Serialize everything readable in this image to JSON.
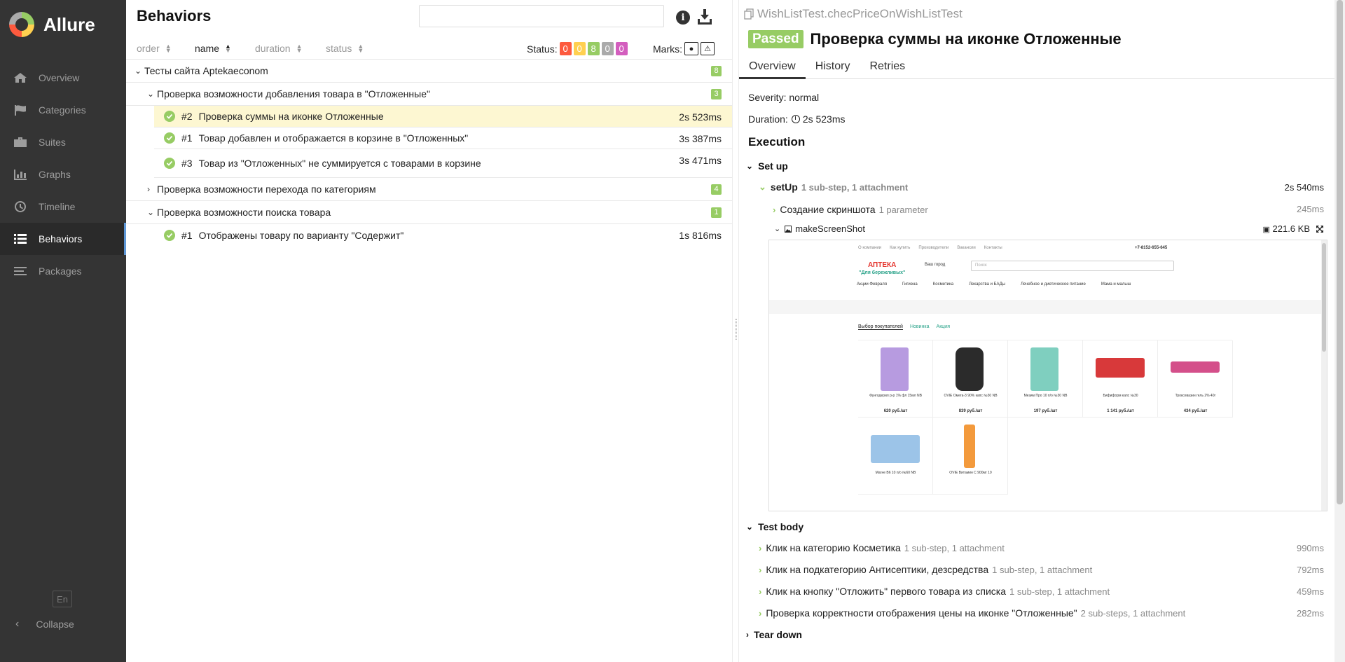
{
  "app": {
    "name": "Allure"
  },
  "sidebar": {
    "items": [
      {
        "label": "Overview",
        "icon": "home-icon"
      },
      {
        "label": "Categories",
        "icon": "flag-icon"
      },
      {
        "label": "Suites",
        "icon": "briefcase-icon"
      },
      {
        "label": "Graphs",
        "icon": "bar-chart-icon"
      },
      {
        "label": "Timeline",
        "icon": "clock-icon"
      },
      {
        "label": "Behaviors",
        "icon": "list-icon",
        "active": true
      },
      {
        "label": "Packages",
        "icon": "stack-icon"
      }
    ],
    "lang": "En",
    "collapse": "Collapse"
  },
  "behaviors": {
    "title": "Behaviors",
    "search_value": "",
    "sort": {
      "order": "order",
      "name": "name",
      "duration": "duration",
      "status": "status"
    },
    "status_label": "Status:",
    "status_counts": [
      {
        "value": "0",
        "color": "#fd5a3e"
      },
      {
        "value": "0",
        "color": "#ffd050"
      },
      {
        "value": "8",
        "color": "#97cc64"
      },
      {
        "value": "0",
        "color": "#aaaaaa"
      },
      {
        "value": "0",
        "color": "#d35ebe"
      }
    ],
    "marks_label": "Marks:",
    "epic": {
      "label": "Тесты сайта Aptekaeconom",
      "count": "8"
    },
    "features": [
      {
        "label": "Проверка возможности добавления товара в \"Отложенные\"",
        "count": "3",
        "expanded": true,
        "tests": [
          {
            "num": "#2",
            "name": "Проверка суммы на иконке Отложенные",
            "duration": "2s 523ms",
            "selected": true
          },
          {
            "num": "#1",
            "name": "Товар добавлен и отображается в корзине в \"Отложенных\"",
            "duration": "3s 387ms"
          },
          {
            "num": "#3",
            "name": "Товар из \"Отложенных\" не суммируется с товарами в корзине",
            "duration": "3s 471ms"
          }
        ]
      },
      {
        "label": "Проверка возможности перехода по категориям",
        "count": "4",
        "expanded": false,
        "tests": []
      },
      {
        "label": "Проверка возможности поиска товара",
        "count": "1",
        "expanded": true,
        "tests": [
          {
            "num": "#1",
            "name": "Отображены товару по варианту \"Содержит\"",
            "duration": "1s 816ms"
          }
        ]
      }
    ]
  },
  "testcase": {
    "fullname": "WishListTest.checPriceOnWishListTest",
    "status": "Passed",
    "title": "Проверка суммы на иконке Отложенные",
    "tabs": [
      "Overview",
      "History",
      "Retries"
    ],
    "severity": "Severity: normal",
    "duration_label": "Duration:",
    "duration": "2s 523ms",
    "execution_title": "Execution",
    "setup": {
      "title": "Set up",
      "step": {
        "name": "setUp",
        "meta": "1 sub-step, 1 attachment",
        "duration": "2s 540ms"
      },
      "substep": {
        "name": "Создание скриншота",
        "meta": "1 parameter",
        "duration": "245ms"
      },
      "attachment": {
        "name": "makeScreenShot",
        "size": "221.6 KB"
      }
    },
    "body": {
      "title": "Test body",
      "steps": [
        {
          "name": "Клик на категорию Косметика",
          "meta": "1 sub-step, 1 attachment",
          "duration": "990ms"
        },
        {
          "name": "Клик на подкатегорию Антисептики, дезсредства",
          "meta": "1 sub-step, 1 attachment",
          "duration": "792ms"
        },
        {
          "name": "Клик на кнопку \"Отложить\" первого товара из списка",
          "meta": "1 sub-step, 1 attachment",
          "duration": "459ms"
        },
        {
          "name": "Проверка корректности отображения цены на иконке \"Отложенные\"",
          "meta": "2 sub-steps, 1 attachment",
          "duration": "282ms"
        }
      ]
    },
    "teardown": {
      "title": "Tear down"
    }
  },
  "screenshot": {
    "topnav": [
      "О компании",
      "Как купить",
      "Производители",
      "Вакансии",
      "Контакты"
    ],
    "phone": "+7-8152-655-645",
    "logo_main": "АПТЕКА",
    "logo_sub": "\"Для бережливых\"",
    "city": "Ваш город",
    "search_placeholder": "Поиск",
    "menu": [
      "Акции Февраля",
      "Гигиена",
      "Косметика",
      "Лекарства и БАДы",
      "Лечебное и диетическое питание",
      "Мама и малыш"
    ],
    "tabs": [
      "Выбор покупателей",
      "Новинка",
      "Акция"
    ],
    "products": [
      {
        "name": "Фунгодерил р-р 1% фл 15мл NB",
        "price": "620 руб./шт",
        "color": "#b79be0"
      },
      {
        "name": "OVIE Омега-3 90% капс №30 NB",
        "price": "839 руб./шт",
        "color": "#2b2b2b"
      },
      {
        "name": "Мезим Про 10 п/о №30 NB",
        "price": "197 руб./шт",
        "color": "#7fcfbf"
      },
      {
        "name": "Бифиформ капс №30",
        "price": "1 141 руб./шт",
        "color": "#d8393a"
      },
      {
        "name": "Троксевазин гель 2% 40г",
        "price": "434 руб./шт",
        "color": "#d44f8a"
      },
      {
        "name": "Магне B6 10 п/о №60 NB",
        "price": "",
        "color": "#9cc4e8"
      },
      {
        "name": "OVIE Витамин С 900мг 10",
        "price": "",
        "color": "#f39a3c"
      }
    ]
  }
}
